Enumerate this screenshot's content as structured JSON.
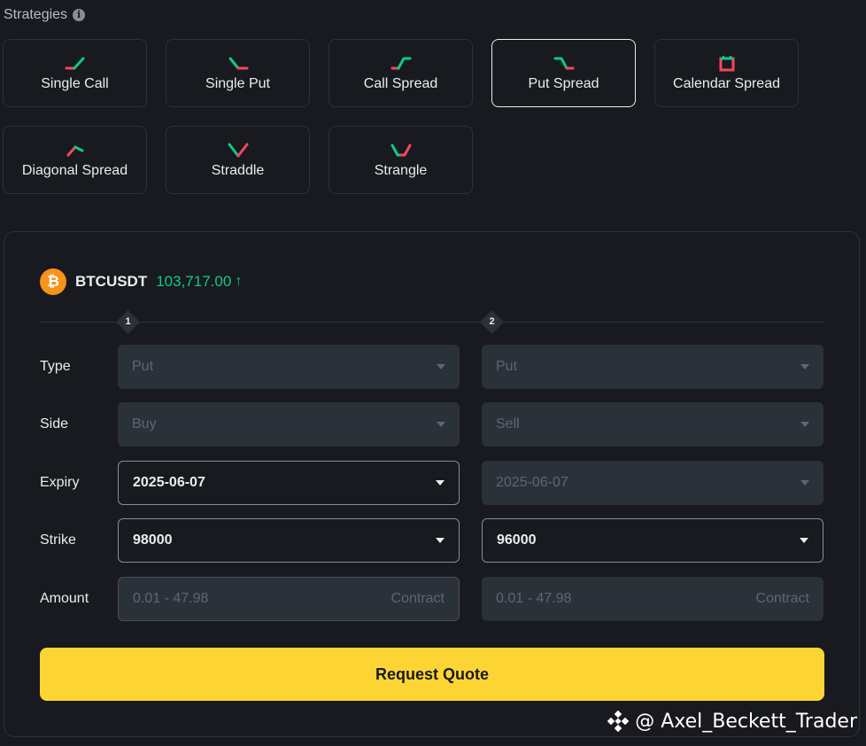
{
  "header": {
    "title": "Strategies",
    "info_icon": "info-icon"
  },
  "strategies": [
    {
      "label": "Single Call",
      "icon": "single-call-icon",
      "selected": false
    },
    {
      "label": "Single Put",
      "icon": "single-put-icon",
      "selected": false
    },
    {
      "label": "Call Spread",
      "icon": "call-spread-icon",
      "selected": false
    },
    {
      "label": "Put Spread",
      "icon": "put-spread-icon",
      "selected": true
    },
    {
      "label": "Calendar Spread",
      "icon": "calendar-spread-icon",
      "selected": false
    },
    {
      "label": "Diagonal Spread",
      "icon": "diagonal-spread-icon",
      "selected": false
    },
    {
      "label": "Straddle",
      "icon": "straddle-icon",
      "selected": false
    },
    {
      "label": "Strangle",
      "icon": "strangle-icon",
      "selected": false
    }
  ],
  "symbol": {
    "logo_text": "₿",
    "name": "BTCUSDT",
    "price": "103,717.00",
    "arrow": "↑"
  },
  "legs": {
    "leg1": "1",
    "leg2": "2"
  },
  "form": {
    "type": {
      "label": "Type",
      "leg1": "Put",
      "leg2": "Put"
    },
    "side": {
      "label": "Side",
      "leg1": "Buy",
      "leg2": "Sell"
    },
    "expiry": {
      "label": "Expiry",
      "leg1": "2025-06-07",
      "leg2": "2025-06-07"
    },
    "strike": {
      "label": "Strike",
      "leg1": "98000",
      "leg2": "96000"
    },
    "amount": {
      "label": "Amount",
      "placeholder": "0.01 - 47.98",
      "unit": "Contract"
    }
  },
  "actions": {
    "request_quote": "Request Quote"
  },
  "watermark": {
    "text": "@ Axel_Beckett_Trader"
  },
  "colors": {
    "up_green": "#0ecb81",
    "down_red": "#f6465d",
    "accent_yellow": "#fcd535",
    "btc_orange": "#f7931a"
  }
}
